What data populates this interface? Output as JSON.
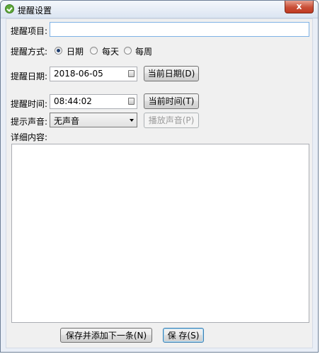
{
  "window": {
    "title": "提醒设置",
    "close_label": "x"
  },
  "form": {
    "item_label": "提醒项目:",
    "item_value": "",
    "mode_label": "提醒方式:",
    "mode_options": [
      {
        "label": "日期",
        "checked": true
      },
      {
        "label": "每天",
        "checked": false
      },
      {
        "label": "每周",
        "checked": false
      }
    ],
    "date_label": "提醒日期:",
    "date_value": "2018-06-05",
    "current_date_button": "当前日期(D)",
    "time_label": "提醒时间:",
    "time_value": "08:44:02",
    "current_time_button": "当前时间(T)",
    "sound_label": "提示声音:",
    "sound_value": "无声音",
    "play_sound_button": "播放声音(P)",
    "details_label": "详细内容:",
    "details_value": ""
  },
  "footer": {
    "save_add_next_button": "保存并添加下一条(N)",
    "save_button": "保 存(S)"
  },
  "icons": {
    "app": "check-circle-icon",
    "close": "close-icon",
    "calendar": "calendar-icon",
    "dropdown": "chevron-down-icon"
  }
}
